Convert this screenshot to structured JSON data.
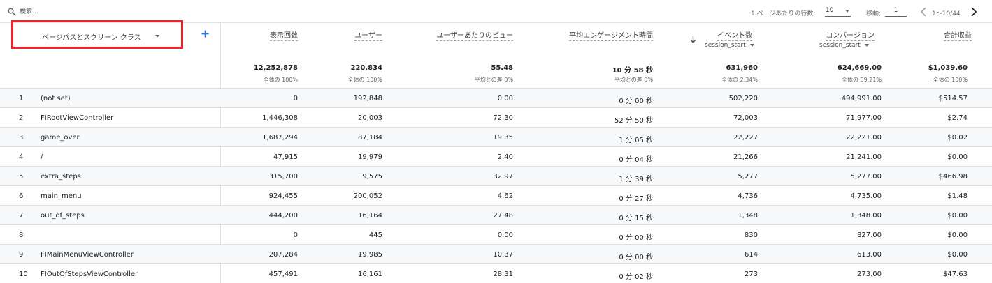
{
  "toolbar": {
    "search_placeholder": "検索...",
    "rows_per_page_label": "1 ページあたりの行数:",
    "rows_per_page_value": "10",
    "goto_label": "移動:",
    "goto_value": "1",
    "range": "1〜10/44"
  },
  "icons": {
    "search": "search-icon",
    "prev": "chevron-left-icon",
    "next": "chevron-right-icon",
    "add": "plus-icon",
    "sort": "arrow-down-icon",
    "dropdown": "caret-down-icon"
  },
  "colors": {
    "highlight_border": "#e8262d",
    "accent_blue": "#1a73e8",
    "row_stripe": "#f8f9fa",
    "divider": "#e0e0e0"
  },
  "dimension_header": "ページパスとスクリーン クラス",
  "metrics": [
    {
      "label": "表示回数",
      "sub": "",
      "total": "12,252,878",
      "total_sub": "全体の 100%"
    },
    {
      "label": "ユーザー",
      "sub": "",
      "total": "220,834",
      "total_sub": "全体の 100%"
    },
    {
      "label": "ユーザーあたりのビュー",
      "sub": "",
      "total": "55.48",
      "total_sub": "平均との差 0%"
    },
    {
      "label": "平均エンゲージメント時間",
      "sub": "",
      "total": "10 分 58 秒",
      "total_sub": "平均との差 0%"
    },
    {
      "label": "イベント数",
      "sub": "session_start",
      "total": "631,960",
      "total_sub": "全体の 2.34%"
    },
    {
      "label": "コンバージョン",
      "sub": "session_start",
      "total": "624,669.00",
      "total_sub": "全体の 59.21%"
    },
    {
      "label": "合計収益",
      "sub": "",
      "total": "$1,039.60",
      "total_sub": "全体の 100%"
    }
  ],
  "rows": [
    {
      "idx": "1",
      "dim": "(not set)",
      "vals": [
        "0",
        "192,848",
        "0.00",
        "0 分 00 秒",
        "502,220",
        "494,991.00",
        "$514.57"
      ]
    },
    {
      "idx": "2",
      "dim": "FIRootViewController",
      "vals": [
        "1,446,308",
        "20,003",
        "72.30",
        "52 分 50 秒",
        "72,003",
        "71,977.00",
        "$2.74"
      ]
    },
    {
      "idx": "3",
      "dim": "game_over",
      "vals": [
        "1,687,294",
        "87,184",
        "19.35",
        "1 分 05 秒",
        "22,227",
        "22,221.00",
        "$0.02"
      ]
    },
    {
      "idx": "4",
      "dim": "/",
      "vals": [
        "47,915",
        "19,979",
        "2.40",
        "0 分 04 秒",
        "21,266",
        "21,241.00",
        "$0.00"
      ]
    },
    {
      "idx": "5",
      "dim": "extra_steps",
      "vals": [
        "315,700",
        "9,575",
        "32.97",
        "1 分 39 秒",
        "5,277",
        "5,277.00",
        "$466.98"
      ]
    },
    {
      "idx": "6",
      "dim": "main_menu",
      "vals": [
        "924,455",
        "200,052",
        "4.62",
        "0 分 27 秒",
        "4,736",
        "4,735.00",
        "$1.48"
      ]
    },
    {
      "idx": "7",
      "dim": "out_of_steps",
      "vals": [
        "444,200",
        "16,164",
        "27.48",
        "0 分 15 秒",
        "1,348",
        "1,348.00",
        "$0.00"
      ]
    },
    {
      "idx": "8",
      "dim": "",
      "vals": [
        "0",
        "445",
        "0.00",
        "0 分 00 秒",
        "830",
        "827.00",
        "$0.00"
      ]
    },
    {
      "idx": "9",
      "dim": "FIMainMenuViewController",
      "vals": [
        "207,284",
        "19,985",
        "10.37",
        "0 分 00 秒",
        "614",
        "613.00",
        "$0.00"
      ]
    },
    {
      "idx": "10",
      "dim": "FIOutOfStepsViewController",
      "vals": [
        "457,491",
        "16,161",
        "28.31",
        "0 分 02 秒",
        "273",
        "273.00",
        "$47.63"
      ]
    }
  ]
}
